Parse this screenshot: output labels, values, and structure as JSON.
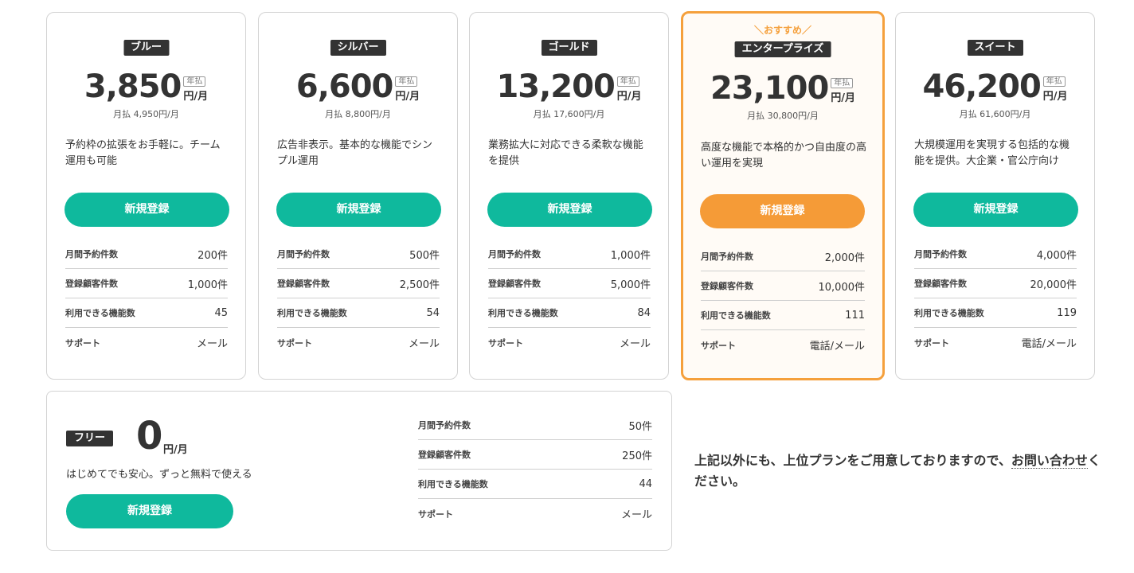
{
  "plans": [
    {
      "name": "ブルー",
      "price": "3,850",
      "billing_tag": "年払",
      "unit": "円/月",
      "monthly_note": "月払 4,950円/月",
      "description": "予約枠の拡張をお手軽に。チーム運用も可能",
      "signup_label": "新規登録",
      "specs": [
        {
          "label": "月間予約件数",
          "value": "200件"
        },
        {
          "label": "登録顧客件数",
          "value": "1,000件"
        },
        {
          "label": "利用できる機能数",
          "value": "45"
        },
        {
          "label": "サポート",
          "value": "メール"
        }
      ]
    },
    {
      "name": "シルバー",
      "price": "6,600",
      "billing_tag": "年払",
      "unit": "円/月",
      "monthly_note": "月払 8,800円/月",
      "description": "広告非表示。基本的な機能でシンプル運用",
      "signup_label": "新規登録",
      "specs": [
        {
          "label": "月間予約件数",
          "value": "500件"
        },
        {
          "label": "登録顧客件数",
          "value": "2,500件"
        },
        {
          "label": "利用できる機能数",
          "value": "54"
        },
        {
          "label": "サポート",
          "value": "メール"
        }
      ]
    },
    {
      "name": "ゴールド",
      "price": "13,200",
      "billing_tag": "年払",
      "unit": "円/月",
      "monthly_note": "月払 17,600円/月",
      "description": "業務拡大に対応できる柔軟な機能を提供",
      "signup_label": "新規登録",
      "specs": [
        {
          "label": "月間予約件数",
          "value": "1,000件"
        },
        {
          "label": "登録顧客件数",
          "value": "5,000件"
        },
        {
          "label": "利用できる機能数",
          "value": "84"
        },
        {
          "label": "サポート",
          "value": "メール"
        }
      ]
    },
    {
      "name": "エンタープライズ",
      "recommend_label": "＼おすすめ／",
      "price": "23,100",
      "billing_tag": "年払",
      "unit": "円/月",
      "monthly_note": "月払 30,800円/月",
      "description": "高度な機能で本格的かつ自由度の高い運用を実現",
      "signup_label": "新規登録",
      "specs": [
        {
          "label": "月間予約件数",
          "value": "2,000件"
        },
        {
          "label": "登録顧客件数",
          "value": "10,000件"
        },
        {
          "label": "利用できる機能数",
          "value": "111"
        },
        {
          "label": "サポート",
          "value": "電話/メール"
        }
      ]
    },
    {
      "name": "スイート",
      "price": "46,200",
      "billing_tag": "年払",
      "unit": "円/月",
      "monthly_note": "月払 61,600円/月",
      "description": "大規模運用を実現する包括的な機能を提供。大企業・官公庁向け",
      "signup_label": "新規登録",
      "specs": [
        {
          "label": "月間予約件数",
          "value": "4,000件"
        },
        {
          "label": "登録顧客件数",
          "value": "20,000件"
        },
        {
          "label": "利用できる機能数",
          "value": "119"
        },
        {
          "label": "サポート",
          "value": "電話/メール"
        }
      ]
    }
  ],
  "free_plan": {
    "name": "フリー",
    "price": "0",
    "unit": "円/月",
    "description": "はじめてでも安心。ずっと無料で使える",
    "signup_label": "新規登録",
    "specs": [
      {
        "label": "月間予約件数",
        "value": "50件"
      },
      {
        "label": "登録顧客件数",
        "value": "250件"
      },
      {
        "label": "利用できる機能数",
        "value": "44"
      },
      {
        "label": "サポート",
        "value": "メール"
      }
    ]
  },
  "contact_note": {
    "text_before": "上記以外にも、上位プランをご用意しておりますので、",
    "link_text": "お問い合わせ",
    "text_after": "ください。"
  },
  "colors": {
    "accent_green": "#0fb99d",
    "accent_orange": "#f59b37",
    "featured_border": "#f5a03c"
  }
}
